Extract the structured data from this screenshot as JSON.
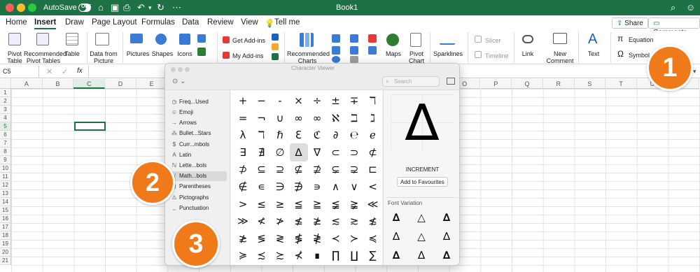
{
  "titlebar": {
    "autosave": "AutoSave",
    "toggle": "OFF",
    "doc_title": "Book1"
  },
  "ribbon_tabs": [
    "Home",
    "Insert",
    "Draw",
    "Page Layout",
    "Formulas",
    "Data",
    "Review",
    "View"
  ],
  "tell_me": "Tell me",
  "share": "Share",
  "comments": "Comments",
  "ribbon": {
    "pivot_table": [
      "Pivot",
      "Table"
    ],
    "recommended_pivot": [
      "Recommended",
      "Pivot Tables"
    ],
    "table": "Table",
    "data_from_picture": [
      "Data from",
      "Picture"
    ],
    "pictures": "Pictures",
    "shapes": "Shapes",
    "icons": "Icons",
    "get_addins": "Get Add-ins",
    "my_addins": "My Add-ins",
    "recommended_charts": [
      "Recommended",
      "Charts"
    ],
    "maps": "Maps",
    "pivot_chart": [
      "Pivot",
      "Chart"
    ],
    "sparklines": "Sparklines",
    "slicer": "Slicer",
    "timeline": "Timeline",
    "link": "Link",
    "new_comment": [
      "New",
      "Comment"
    ],
    "text": "Text",
    "equation": "Equation",
    "symbol": "Symbol"
  },
  "formula_bar": {
    "name_box": "C5",
    "fx": "fx"
  },
  "columns": [
    "A",
    "B",
    "C",
    "D",
    "E",
    "F",
    "G",
    "H",
    "I",
    "J",
    "K",
    "L",
    "M",
    "N",
    "O",
    "P",
    "Q",
    "R",
    "S",
    "T",
    "U",
    "V"
  ],
  "rows": [
    "1",
    "2",
    "3",
    "4",
    "5",
    "6",
    "7",
    "8",
    "9",
    "10",
    "11",
    "12",
    "13",
    "14",
    "15",
    "16",
    "17",
    "18",
    "19",
    "20",
    "21"
  ],
  "character_viewer": {
    "title": "Character Viewer",
    "search_placeholder": "Search",
    "categories": [
      "Freq...Used",
      "Emoji",
      "Arrows",
      "Bullet...Stars",
      "Curr...mbols",
      "Latin",
      "Lette...bols",
      "Math...bols",
      "Parentheses",
      "Pictographs",
      "Punctuation"
    ],
    "category_icons": [
      "◷",
      "☺",
      "→",
      "⁂",
      "$",
      "A",
      "ℕ",
      "√",
      "()",
      "⚠",
      "‚,"
    ],
    "selected_category": "Math...bols",
    "chars": [
      "+",
      "−",
      "-",
      "×",
      "÷",
      "±",
      "∓",
      "ℸ",
      "=",
      "¬",
      "∪",
      "∞",
      "∞",
      "ℵ",
      "ℶ",
      "ℷ",
      "λ",
      "ℸ",
      "ℏ",
      "ℇ",
      "ℭ",
      "∂",
      "℮",
      "ℯ",
      "∃",
      "∄",
      "∅",
      "∆",
      "∇",
      "⊂",
      "⊃",
      "⊄",
      "⊅",
      "⊆",
      "⊇",
      "⊈",
      "⊉",
      "⊊",
      "⊋",
      "⊏",
      "∉",
      "∊",
      "∋",
      "∌",
      "∍",
      "∧",
      "∨",
      "<",
      ">",
      "≤",
      "≥",
      "≦",
      "≧",
      "≨",
      "≩",
      "≪",
      "≫",
      "≮",
      "≯",
      "≰",
      "≱",
      "≲",
      "≳",
      "≴",
      "≵",
      "≶",
      "≷",
      "≸",
      "≹",
      "≺",
      "≻",
      "≼",
      "≽",
      "≾",
      "≿",
      "⊀",
      "∎",
      "∏",
      "∐",
      "∑"
    ],
    "selected_char": "∆",
    "preview_char": "∆",
    "char_name": "INCREMENT",
    "add_favourites": "Add to Favourites",
    "font_variation": "Font Variation",
    "variations": [
      "∆",
      "△",
      "∆",
      "∆",
      "△",
      "∆",
      "∆",
      "∆",
      "∆"
    ]
  },
  "badges": [
    "1",
    "2",
    "3"
  ]
}
